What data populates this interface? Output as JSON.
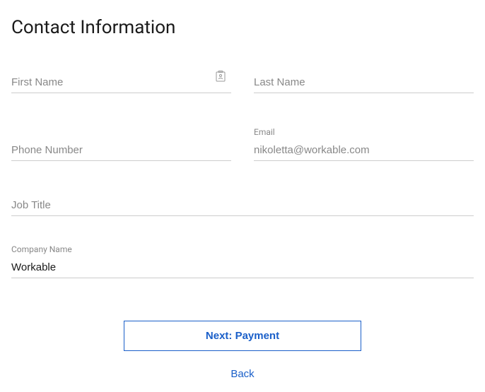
{
  "title": "Contact Information",
  "fields": {
    "firstName": {
      "placeholder": "First Name",
      "value": ""
    },
    "lastName": {
      "placeholder": "Last Name",
      "value": ""
    },
    "phone": {
      "placeholder": "Phone Number",
      "value": ""
    },
    "email": {
      "label": "Email",
      "value": "nikoletta@workable.com"
    },
    "jobTitle": {
      "placeholder": "Job Title",
      "value": ""
    },
    "companyName": {
      "label": "Company Name",
      "value": "Workable"
    }
  },
  "actions": {
    "nextLabel": "Next: Payment",
    "backLabel": "Back"
  }
}
